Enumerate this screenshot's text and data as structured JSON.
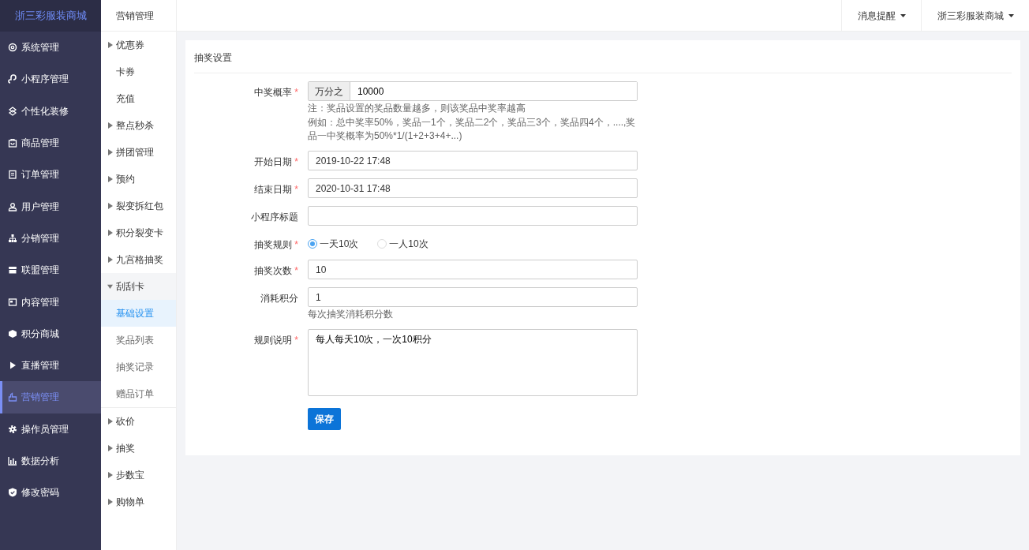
{
  "brand": "浙三彩服装商城",
  "sidebar": {
    "items": [
      {
        "label": "系统管理",
        "selected": false
      },
      {
        "label": "小程序管理",
        "selected": false
      },
      {
        "label": "个性化装修",
        "selected": false
      },
      {
        "label": "商品管理",
        "selected": false
      },
      {
        "label": "订单管理",
        "selected": false
      },
      {
        "label": "用户管理",
        "selected": false
      },
      {
        "label": "分销管理",
        "selected": false
      },
      {
        "label": "联盟管理",
        "selected": false
      },
      {
        "label": "内容管理",
        "selected": false
      },
      {
        "label": "积分商城",
        "selected": false
      },
      {
        "label": "直播管理",
        "selected": false
      },
      {
        "label": "营销管理",
        "selected": true
      },
      {
        "label": "操作员管理",
        "selected": false
      },
      {
        "label": "数据分析",
        "selected": false
      },
      {
        "label": "修改密码",
        "selected": false
      }
    ]
  },
  "submenu": {
    "title": "营销管理",
    "items": [
      {
        "label": "优惠券",
        "kind": "group",
        "expanded": false
      },
      {
        "label": "卡券",
        "kind": "link",
        "selected": false
      },
      {
        "label": "充值",
        "kind": "link",
        "selected": false
      },
      {
        "label": "整点秒杀",
        "kind": "group",
        "expanded": false
      },
      {
        "label": "拼团管理",
        "kind": "group",
        "expanded": false
      },
      {
        "label": "预约",
        "kind": "group",
        "expanded": false
      },
      {
        "label": "裂变拆红包",
        "kind": "group",
        "expanded": false
      },
      {
        "label": "积分裂变卡",
        "kind": "group",
        "expanded": false
      },
      {
        "label": "九宫格抽奖",
        "kind": "group",
        "expanded": false
      },
      {
        "label": "刮刮卡",
        "kind": "group",
        "expanded": true,
        "children": [
          {
            "label": "基础设置",
            "selected": true
          },
          {
            "label": "奖品列表",
            "selected": false
          },
          {
            "label": "抽奖记录",
            "selected": false
          },
          {
            "label": "赠品订单",
            "selected": false
          }
        ]
      },
      {
        "label": "砍价",
        "kind": "group",
        "expanded": false
      },
      {
        "label": "抽奖",
        "kind": "group",
        "expanded": false
      },
      {
        "label": "步数宝",
        "kind": "group",
        "expanded": false
      },
      {
        "label": "购物单",
        "kind": "group",
        "expanded": false
      }
    ]
  },
  "topbar": {
    "menus": [
      "消息提醒",
      "浙三彩服装商城"
    ]
  },
  "panel": {
    "title": "抽奖设置",
    "fields": [
      {
        "kind": "prefixed",
        "label": "中奖概率",
        "required_mark": "*",
        "prefix": "万分之",
        "value": "10000",
        "hints": [
          "注：奖品设置的奖品数量越多，则该奖品中奖率越高",
          "例如：总中奖率50%，奖品一1个，奖品二2个，奖品三3个，奖品四4个，....,奖品一中奖概率为50%*1/(1+2+3+4+...)"
        ]
      },
      {
        "kind": "input",
        "label": "开始日期",
        "required_mark": "*",
        "value": "2019-10-22 17:48"
      },
      {
        "kind": "input",
        "label": "结束日期",
        "required_mark": "*",
        "value": "2020-10-31 17:48"
      },
      {
        "kind": "input",
        "label": "小程序标题"
      },
      {
        "kind": "radio",
        "label": "抽奖规则",
        "required_mark": "*",
        "options": [
          {
            "label": "一天10次",
            "selected": true
          },
          {
            "label": "一人10次",
            "selected": false
          }
        ]
      },
      {
        "kind": "input",
        "label": "抽奖次数",
        "required_mark": "*",
        "value": "10"
      },
      {
        "kind": "input",
        "label": "消耗积分",
        "value": "1",
        "hints": [
          "每次抽奖消耗积分数"
        ]
      },
      {
        "kind": "textarea",
        "label": "规则说明",
        "required_mark": "*",
        "value": "每人每天10次，一次10积分"
      }
    ],
    "save_button": "保存"
  }
}
